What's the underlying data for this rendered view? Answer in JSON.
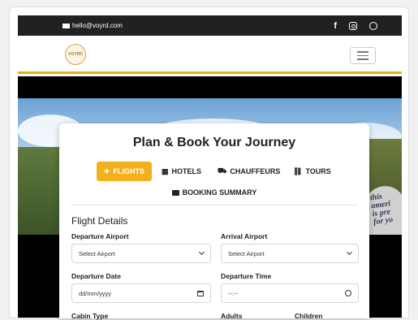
{
  "topbar": {
    "email": "hello@voyrd.com",
    "social_icons": [
      "facebook-icon",
      "instagram-icon",
      "whatsapp-icon"
    ],
    "facebook_glyph": "f"
  },
  "navbar": {
    "logo_text": "VOYRD",
    "menu_icon": "hamburger-icon"
  },
  "hero": {
    "sign_text": [
      "this",
      "ameri",
      "is pre",
      "for yo"
    ]
  },
  "booking": {
    "title": "Plan & Book Your Journey",
    "tabs": [
      {
        "label": "FLIGHTS",
        "icon": "plane-icon",
        "glyph": "✈",
        "active": true
      },
      {
        "label": "HOTELS",
        "icon": "hotel-icon",
        "glyph": "▦",
        "active": false
      },
      {
        "label": "CHAUFFEURS",
        "icon": "car-icon",
        "glyph": "⛟",
        "active": false
      },
      {
        "label": "TOURS",
        "icon": "tours-icon",
        "glyph": "⛓",
        "active": false
      }
    ],
    "summary_label": "BOOKING SUMMARY",
    "section_title": "Flight Details",
    "fields": {
      "departure_airport_label": "Departure Airport",
      "departure_airport_value": "Select Airport",
      "arrival_airport_label": "Arrival Airport",
      "arrival_airport_value": "Select Airport",
      "departure_date_label": "Departure Date",
      "departure_date_placeholder": "dd/mm/yyyy",
      "departure_time_label": "Departure Time",
      "departure_time_placeholder": "--:--",
      "cabin_type_label": "Cabin Type",
      "adults_label": "Adults",
      "children_label": "Children"
    }
  },
  "colors": {
    "accent": "#f2b01e",
    "topbar_bg": "#1f2220",
    "nav_underline": "#e9b10c"
  }
}
